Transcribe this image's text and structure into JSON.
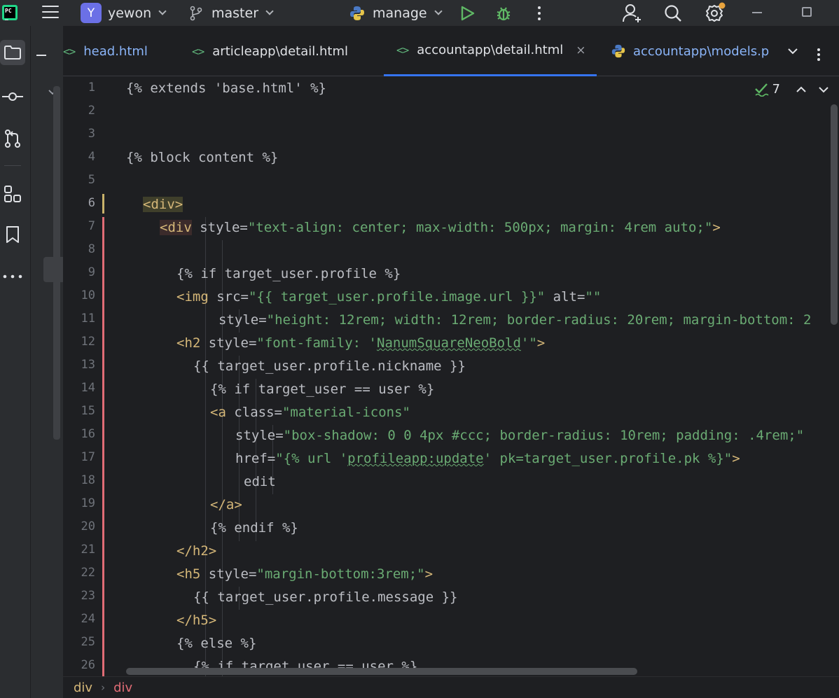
{
  "titlebar": {
    "project_initial": "Y",
    "project_name": "yewon",
    "branch": "master",
    "run_config": "manage"
  },
  "tabs": [
    {
      "label": "head.html",
      "icon": "html-icon",
      "active": false
    },
    {
      "label": "articleapp\\detail.html",
      "icon": "html-icon",
      "active": false
    },
    {
      "label": "accountapp\\detail.html",
      "icon": "html-icon",
      "active": true
    },
    {
      "label": "accountapp\\models.p",
      "icon": "python-icon",
      "active": false
    }
  ],
  "tabs_close": "×",
  "inspection": {
    "count": "7"
  },
  "editor": {
    "active_line": 6,
    "lines": [
      {
        "n": "1"
      },
      {
        "n": "2"
      },
      {
        "n": "3"
      },
      {
        "n": "4"
      },
      {
        "n": "5"
      },
      {
        "n": "6"
      },
      {
        "n": "7"
      },
      {
        "n": "8"
      },
      {
        "n": "9"
      },
      {
        "n": "10"
      },
      {
        "n": "11"
      },
      {
        "n": "12"
      },
      {
        "n": "13"
      },
      {
        "n": "14"
      },
      {
        "n": "15"
      },
      {
        "n": "16"
      },
      {
        "n": "17"
      },
      {
        "n": "18"
      },
      {
        "n": "19"
      },
      {
        "n": "20"
      },
      {
        "n": "21"
      },
      {
        "n": "22"
      },
      {
        "n": "23"
      },
      {
        "n": "24"
      },
      {
        "n": "25"
      },
      {
        "n": "26"
      }
    ],
    "code": {
      "l1": "{% extends 'base.html' %}",
      "l4": "{% block content %}",
      "l6_tag": "<div>",
      "l7_tag": "<div",
      "l7_attr": " style=",
      "l7_val": "\"text-align: center; max-width: 500px; margin: 4rem auto;\"",
      "l7_end": ">",
      "l9": "{% if target_user.profile %}",
      "l10_tag": "<img",
      "l10_attr": " src=",
      "l10_val": "\"{{ target_user.profile.image.url }}\"",
      "l10_attr2": " alt=",
      "l10_val2": "\"\"",
      "l11_attr": "style=",
      "l11_val": "\"height: 12rem; width: 12rem; border-radius: 20rem; margin-bottom: 2",
      "l12_tag": "<h2",
      "l12_attr": " style=",
      "l12_val_a": "\"font-family: '",
      "l12_val_b": "NanumSquareNeoBold",
      "l12_val_c": "'\"",
      "l12_end": ">",
      "l13": "{{ target_user.profile.nickname }}",
      "l14": "{% if target_user == user %}",
      "l15_tag": "<a",
      "l15_attr": " class=",
      "l15_val": "\"material-icons\"",
      "l16_attr": "style=",
      "l16_val": "\"box-shadow: 0 0 4px #ccc; border-radius: 10rem; padding: .4rem;\"",
      "l17_attr": "href=",
      "l17_val_a": "\"{% url '",
      "l17_val_b": "profileapp:update",
      "l17_val_c": "' pk=target_user.profile.pk %}\"",
      "l17_end": ">",
      "l18": "edit",
      "l19": "</a>",
      "l20": "{% endif %}",
      "l21": "</h2>",
      "l22_tag": "<h5",
      "l22_attr": " style=",
      "l22_val": "\"margin-bottom:3rem;\"",
      "l22_end": ">",
      "l23": "{{ target_user.profile.message }}",
      "l24": "</h5>",
      "l25": "{% else %}",
      "l26": "{% if target_user == user %}"
    }
  },
  "breadcrumbs": [
    "div",
    "div"
  ],
  "colors": {
    "tag": "#d5b778",
    "string": "#6aab73",
    "text": "#bcbec4",
    "accent": "#3574f0",
    "change_bar": "#e06c75",
    "modified_bar": "#c9b26a"
  }
}
